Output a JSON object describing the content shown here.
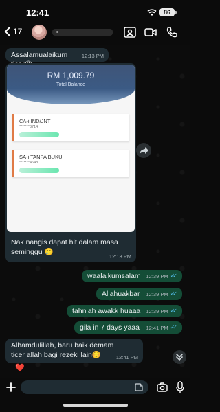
{
  "status": {
    "time": "12:41",
    "battery": "86"
  },
  "header": {
    "back_count": "17"
  },
  "messages": [
    {
      "id": "m1",
      "type": "in",
      "text": "Assalamualaikum ticer😉",
      "time": "12:13 PM"
    },
    {
      "id": "m2",
      "type": "in",
      "text": "Nak nangis dapat hit dalam masa seminggu 🥲",
      "time": "12:13 PM"
    },
    {
      "id": "m3",
      "type": "out",
      "text": "waalaikumsalam",
      "time": "12:39 PM"
    },
    {
      "id": "m4",
      "type": "out",
      "text": "Allahuakbar",
      "time": "12:39 PM"
    },
    {
      "id": "m5",
      "type": "out",
      "text": "tahniah awakk huaaa",
      "time": "12:39 PM"
    },
    {
      "id": "m6",
      "type": "out",
      "text": "gila in 7 days yaaa",
      "time": "12:41 PM"
    },
    {
      "id": "m7",
      "type": "in",
      "text": "Alhamdulillah, baru baik demam ticer allah bagi rezeki lain☺️",
      "time": "12:41 PM"
    }
  ],
  "image": {
    "amount": "RM 1,009.79",
    "label": "Total Balance",
    "accounts": [
      {
        "name": "CA-i IND/JNT",
        "number": "*******3714"
      },
      {
        "name": "SA-i TANPA BUKU",
        "number": "*******4648"
      }
    ]
  },
  "reaction": "❤️",
  "colors": {
    "incoming": "#1f2c33",
    "outgoing": "#144d37",
    "read_ticks": "#53bdeb"
  }
}
